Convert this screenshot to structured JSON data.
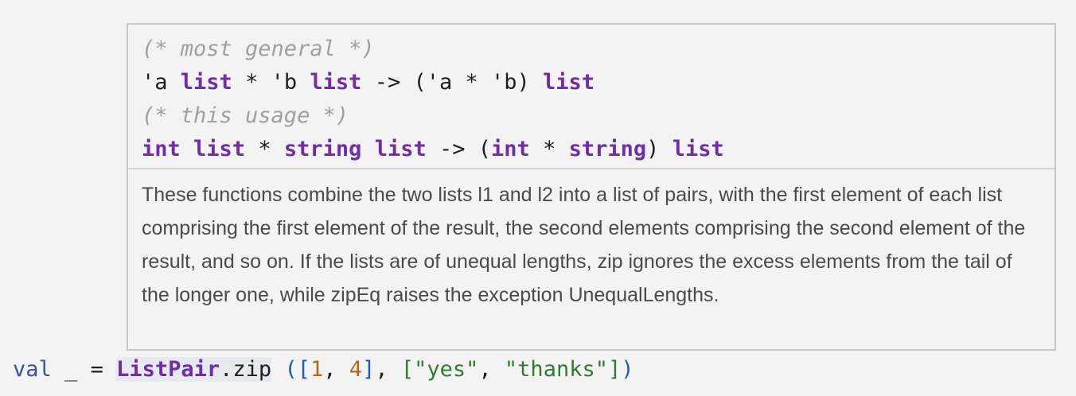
{
  "hover": {
    "signature": {
      "comment_general": "(* most general *)",
      "general": {
        "a": "'a",
        "list": "list",
        "star": "*",
        "b": "'b",
        "arrow": "->",
        "open": "('a * 'b)"
      },
      "comment_usage": "(* this usage *)",
      "usage": {
        "int": "int",
        "list": "list",
        "star": "*",
        "string": "string",
        "arrow": "->",
        "paren_open": "(",
        "paren_close": ")"
      }
    },
    "description": "These functions combine the two lists l1 and l2 into a list of pairs, with the first element of each list comprising the first element of the result, the second elements comprising the second element of the result, and so on. If the lists are of unequal lengths, zip ignores the excess elements from the tail of the longer one, while zipEq raises the exception UnequalLengths."
  },
  "editor": {
    "keyword_val": "val",
    "pattern": "_",
    "equals": "=",
    "module": "ListPair",
    "function": ".zip",
    "open_paren": "(",
    "list_open": "[",
    "num1": "1",
    "comma": ",",
    "num2": "4",
    "list_close": "]",
    "str1": "\"yes\"",
    "str2": "\"thanks\"",
    "close": ")"
  },
  "colors": {
    "keyword": "#6f2da8",
    "comment": "#a0a0a0",
    "string": "#2e7d2e",
    "number": "#b06a1a",
    "bracket": "#2155c9"
  }
}
